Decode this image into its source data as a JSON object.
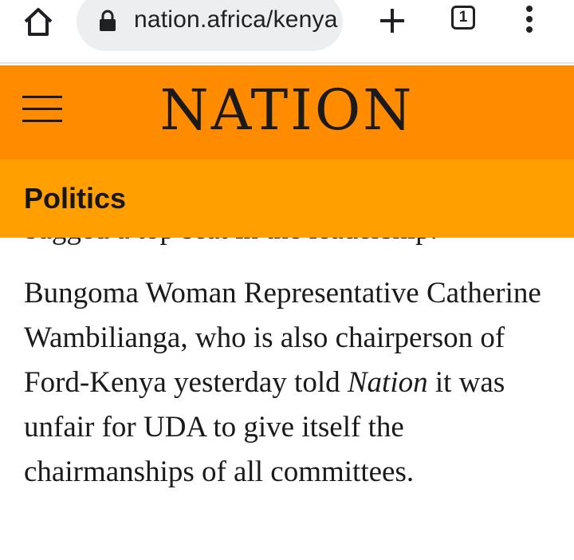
{
  "browser": {
    "url": "nation.africa/kenya",
    "tab_count": "1"
  },
  "site": {
    "logo": "NATION",
    "section": "Politics"
  },
  "article": {
    "partial_line": "bagged a top seat in the leadership.",
    "para_before": "Bungoma Woman Representative Catherine Wambilianga, who is also chairperson of Ford-Kenya yesterday told ",
    "para_em": "Nation",
    "para_after": " it was unfair for UDA to give itself the chairmanships of all committees."
  }
}
